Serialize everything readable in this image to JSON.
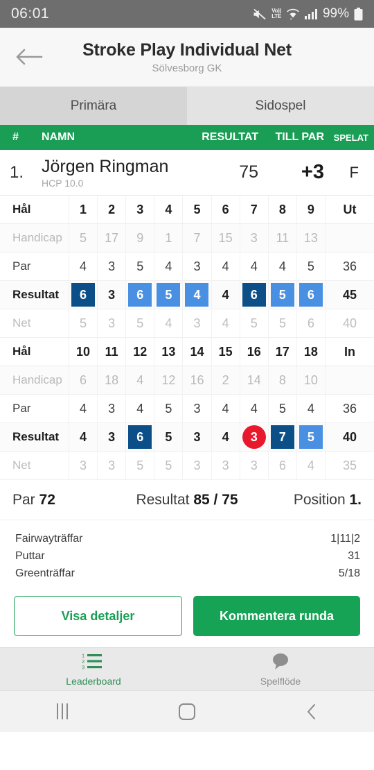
{
  "status_bar": {
    "time": "06:01",
    "battery_percent": "99%",
    "volte_top": "Vo))",
    "volte_bottom": "LTE",
    "icons": [
      "mute-icon",
      "volte-icon",
      "wifi-icon",
      "signal-icon",
      "battery-icon"
    ]
  },
  "app_bar": {
    "title": "Stroke Play Individual Net",
    "subtitle": "Sölvesborg GK",
    "back_icon": "arrow-left-icon"
  },
  "tabs": [
    {
      "label": "Primära",
      "active": true
    },
    {
      "label": "Sidospel",
      "active": false
    }
  ],
  "leaderboard_header": {
    "rank": "#",
    "name": "NAMN",
    "result": "RESULTAT",
    "to_par": "TILL PAR",
    "thru": "SPELAT"
  },
  "player": {
    "rank": "1.",
    "name": "Jörgen Ringman",
    "hcp": "HCP 10.0",
    "result": "75",
    "to_par": "+3",
    "thru": "F"
  },
  "scorecard": {
    "labels": {
      "hole": "Hål",
      "handicap": "Handicap",
      "par": "Par",
      "result": "Resultat",
      "net": "Net"
    },
    "front": {
      "total_label": "Ut",
      "holes": [
        "1",
        "2",
        "3",
        "4",
        "5",
        "6",
        "7",
        "8",
        "9"
      ],
      "handicap": [
        "5",
        "17",
        "9",
        "1",
        "7",
        "15",
        "3",
        "11",
        "13"
      ],
      "handicap_total": "",
      "par": [
        "4",
        "3",
        "5",
        "4",
        "3",
        "4",
        "4",
        "4",
        "5"
      ],
      "par_total": "36",
      "result": [
        "6",
        "3",
        "6",
        "5",
        "4",
        "4",
        "6",
        "5",
        "6"
      ],
      "result_marks": [
        "dblue",
        "none",
        "lblue",
        "lblue",
        "lblue",
        "none",
        "dblue",
        "lblue",
        "lblue"
      ],
      "result_total": "45",
      "net": [
        "5",
        "3",
        "5",
        "4",
        "3",
        "4",
        "5",
        "5",
        "6"
      ],
      "net_total": "40"
    },
    "back": {
      "total_label": "In",
      "holes": [
        "10",
        "11",
        "12",
        "13",
        "14",
        "15",
        "16",
        "17",
        "18"
      ],
      "handicap": [
        "6",
        "18",
        "4",
        "12",
        "16",
        "2",
        "14",
        "8",
        "10"
      ],
      "handicap_total": "",
      "par": [
        "4",
        "3",
        "4",
        "5",
        "3",
        "4",
        "4",
        "5",
        "4"
      ],
      "par_total": "36",
      "result": [
        "4",
        "3",
        "6",
        "5",
        "3",
        "4",
        "3",
        "7",
        "5"
      ],
      "result_marks": [
        "none",
        "none",
        "dblue",
        "none",
        "none",
        "none",
        "red",
        "dblue",
        "lblue"
      ],
      "result_total": "40",
      "net": [
        "3",
        "3",
        "5",
        "5",
        "3",
        "3",
        "3",
        "6",
        "4"
      ],
      "net_total": "35"
    }
  },
  "summary": {
    "par_label": "Par",
    "par_value": "72",
    "result_label": "Resultat",
    "result_value": "85 / 75",
    "position_label": "Position",
    "position_value": "1."
  },
  "stats": [
    {
      "key": "Fairwayträffar",
      "value": "1|11|2"
    },
    {
      "key": "Puttar",
      "value": "31"
    },
    {
      "key": "Greenträffar",
      "value": "5/18"
    }
  ],
  "actions": {
    "details": "Visa detaljer",
    "comment": "Kommentera runda"
  },
  "bottom_nav": [
    {
      "label": "Leaderboard",
      "icon": "numbered-list-icon",
      "active": true
    },
    {
      "label": "Spelflöde",
      "icon": "chat-bubble-icon",
      "active": false
    }
  ],
  "android_nav": {
    "recents": "recents-icon",
    "home": "home-icon",
    "back": "back-icon"
  },
  "colors": {
    "brand_green": "#1a9e55",
    "double_bogey": "#0c4f88",
    "bogey": "#4a90e2",
    "birdie": "#e8192c",
    "status_bar": "#6e6e6e"
  }
}
